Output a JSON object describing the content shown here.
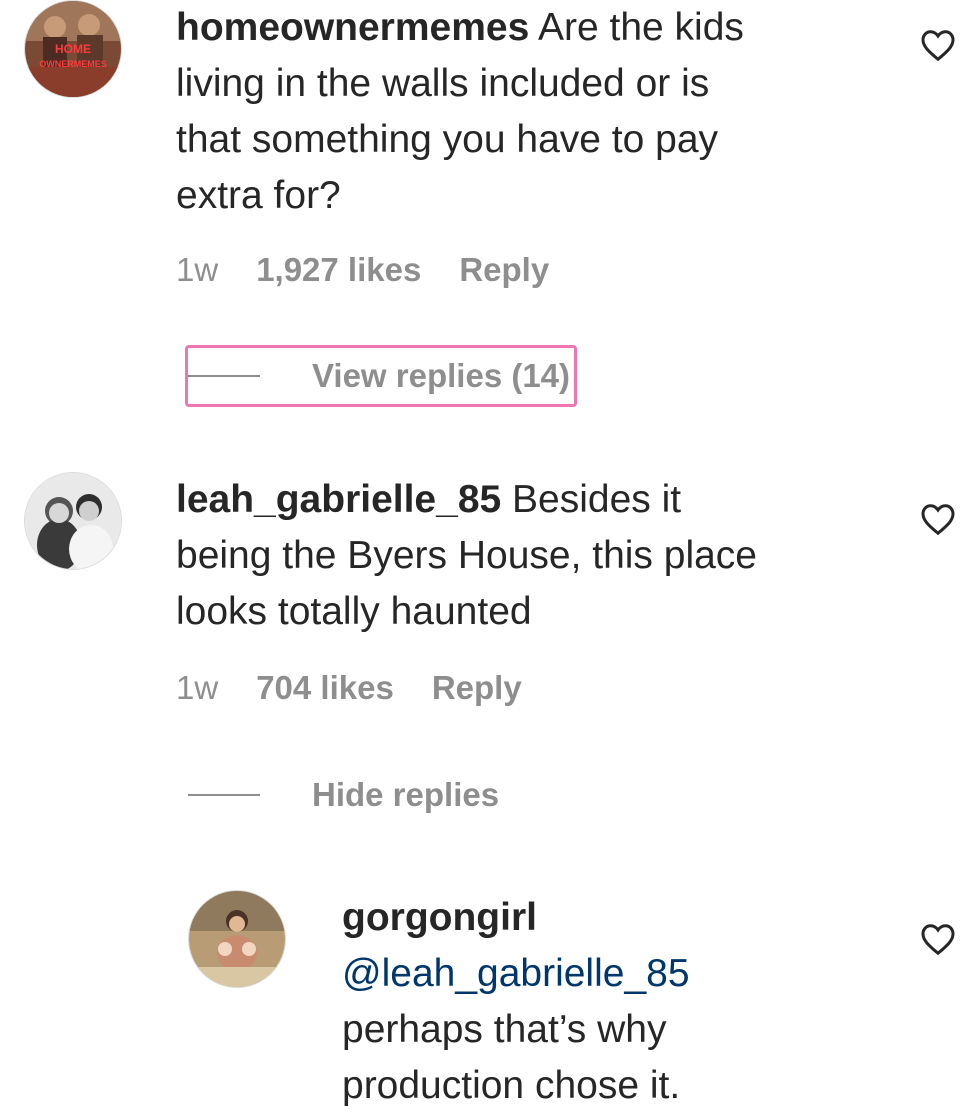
{
  "comments": [
    {
      "username": "homeownermemes",
      "text": "Are the kids living in the walls included or is that something you have to pay extra for?",
      "lines": [
        "Are the kids",
        "living in the walls included or is",
        "that something you have to pay",
        "extra for?"
      ],
      "time": "1w",
      "likes": "1,927 likes",
      "reply_label": "Reply",
      "avatar_text": [
        "HOME",
        "OWNERMEMES"
      ],
      "replies_toggle": "View replies (14)"
    },
    {
      "username": "leah_gabrielle_85",
      "lines": [
        "Besides it",
        "being the Byers House, this place",
        "looks totally haunted"
      ],
      "time": "1w",
      "likes": "704 likes",
      "reply_label": "Reply",
      "replies_toggle": "Hide replies"
    }
  ],
  "reply": {
    "username": "gorgongirl",
    "mention": "@leah_gabrielle_85",
    "lines": [
      "perhaps that’s why",
      "production chose it."
    ]
  },
  "colors": {
    "username": "#262626",
    "meta": "#8e8e8e",
    "mention": "#00376b",
    "highlight": "#f075b0"
  },
  "icons": [
    "heart-icon"
  ]
}
